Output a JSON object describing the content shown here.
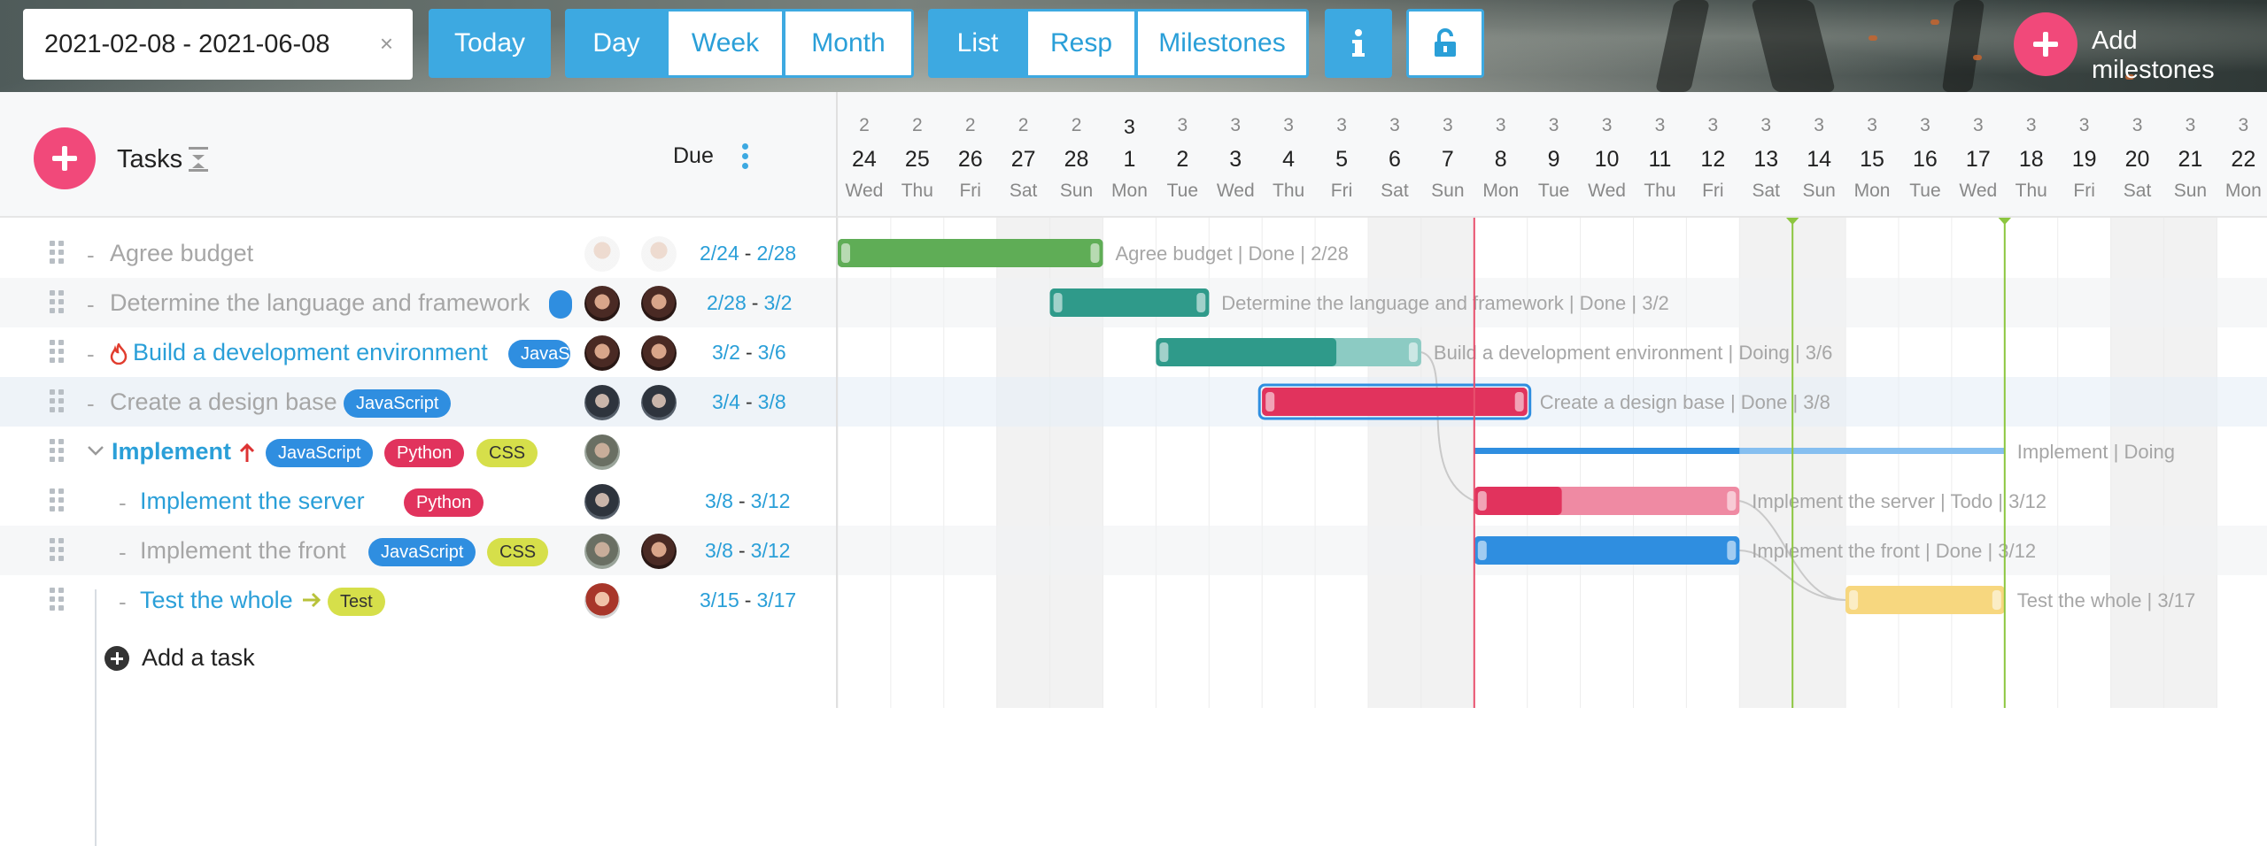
{
  "toolbar": {
    "date_range": "2021-02-08 - 2021-06-08",
    "clear_symbol": "×",
    "today": "Today",
    "views": [
      "Day",
      "Week",
      "Month"
    ],
    "active_view": "Day",
    "modes": [
      "List",
      "Resp",
      "Milestones"
    ],
    "active_mode": "List",
    "info_icon": "info-icon",
    "lock_icon": "unlock-icon",
    "add_milestones": "Add milestones",
    "accent": "#3da9e1",
    "pink": "#f1497a"
  },
  "list_header": {
    "tasks": "Tasks",
    "due": "Due"
  },
  "tasks": [
    {
      "name": "Agree budget",
      "status": "done",
      "tags": [],
      "start": "2/24",
      "due": "2/28",
      "avatars": [
        "light",
        "light"
      ]
    },
    {
      "name": "Determine the language and framework",
      "status": "done",
      "tags": [],
      "start": "2/28",
      "due": "3/2",
      "avatars": [
        "brown",
        "brown"
      ]
    },
    {
      "name": "Build a development environment",
      "status": "active",
      "icon": "fire-icon",
      "tags": [
        "JavaS"
      ],
      "start": "3/2",
      "due": "3/6",
      "avatars": [
        "brown",
        "brown"
      ]
    },
    {
      "name": "Create a design base",
      "status": "done",
      "tags": [
        "JavaScript"
      ],
      "start": "3/4",
      "due": "3/8",
      "avatars": [
        "dark",
        "dark"
      ]
    },
    {
      "name": "Implement",
      "status": "parent",
      "icon": "arrow-up-icon",
      "tags": [
        "JavaScript",
        "Python",
        "CSS"
      ],
      "start": "",
      "due": "",
      "avatars": [
        "grey"
      ]
    },
    {
      "name": "Implement the server",
      "status": "active",
      "tags": [
        "Python"
      ],
      "start": "3/8",
      "due": "3/12",
      "avatars": [
        "dark"
      ]
    },
    {
      "name": "Implement the front",
      "status": "done",
      "tags": [
        "JavaScript",
        "CSS"
      ],
      "start": "3/8",
      "due": "3/12",
      "avatars": [
        "grey",
        "brown"
      ]
    },
    {
      "name": "Test the whole",
      "status": "active",
      "icon": "arrow-right-icon",
      "tags": [
        "Test"
      ],
      "start": "3/15",
      "due": "3/17",
      "avatars": [
        "red"
      ]
    }
  ],
  "add_task": "Add a task",
  "calendar": {
    "days": [
      {
        "m": "2",
        "d": "24",
        "w": "Wed"
      },
      {
        "m": "2",
        "d": "25",
        "w": "Thu"
      },
      {
        "m": "2",
        "d": "26",
        "w": "Fri"
      },
      {
        "m": "2",
        "d": "27",
        "w": "Sat"
      },
      {
        "m": "2",
        "d": "28",
        "w": "Sun"
      },
      {
        "m": "3",
        "d": "1",
        "w": "Mon",
        "first": true
      },
      {
        "m": "3",
        "d": "2",
        "w": "Tue"
      },
      {
        "m": "3",
        "d": "3",
        "w": "Wed"
      },
      {
        "m": "3",
        "d": "4",
        "w": "Thu"
      },
      {
        "m": "3",
        "d": "5",
        "w": "Fri"
      },
      {
        "m": "3",
        "d": "6",
        "w": "Sat"
      },
      {
        "m": "3",
        "d": "7",
        "w": "Sun"
      },
      {
        "m": "3",
        "d": "8",
        "w": "Mon"
      },
      {
        "m": "3",
        "d": "9",
        "w": "Tue"
      },
      {
        "m": "3",
        "d": "10",
        "w": "Wed"
      },
      {
        "m": "3",
        "d": "11",
        "w": "Thu"
      },
      {
        "m": "3",
        "d": "12",
        "w": "Fri"
      },
      {
        "m": "3",
        "d": "13",
        "w": "Sat"
      },
      {
        "m": "3",
        "d": "14",
        "w": "Sun"
      },
      {
        "m": "3",
        "d": "15",
        "w": "Mon"
      },
      {
        "m": "3",
        "d": "16",
        "w": "Tue"
      },
      {
        "m": "3",
        "d": "17",
        "w": "Wed"
      },
      {
        "m": "3",
        "d": "18",
        "w": "Thu"
      },
      {
        "m": "3",
        "d": "19",
        "w": "Fri"
      },
      {
        "m": "3",
        "d": "20",
        "w": "Sat"
      },
      {
        "m": "3",
        "d": "21",
        "w": "Sun"
      },
      {
        "m": "3",
        "d": "22",
        "w": "Mon"
      }
    ],
    "today_index": 12,
    "milestone_indices": [
      18,
      22
    ]
  },
  "bars": [
    {
      "row": 0,
      "start": 0,
      "end": 5,
      "color": "#5fad56",
      "light": "#5fad56",
      "progress": 1.0,
      "label": "Agree budget | Done | 2/28"
    },
    {
      "row": 1,
      "start": 4,
      "end": 7,
      "color": "#2f9a8a",
      "light": "#2f9a8a",
      "progress": 1.0,
      "label": "Determine the language and framework | Done | 3/2"
    },
    {
      "row": 2,
      "start": 6,
      "end": 11,
      "color": "#2f9a8a",
      "light": "#8ccbc3",
      "progress": 0.68,
      "label": "Build a development environment | Doing | 3/6"
    },
    {
      "row": 3,
      "start": 8,
      "end": 13,
      "color": "#e1335d",
      "light": "#e1335d",
      "progress": 1.0,
      "label": "Create a design base | Done | 3/8",
      "selected": true
    },
    {
      "row": 4,
      "start": 12,
      "end": 22,
      "color": "#2f8ee0",
      "light": "#86bff0",
      "progress": 0.5,
      "label": "Implement | Doing",
      "thin": true
    },
    {
      "row": 5,
      "start": 12,
      "end": 17,
      "color": "#e1335d",
      "light": "#ef8aa3",
      "progress": 0.33,
      "label": "Implement the server | Todo | 3/12"
    },
    {
      "row": 6,
      "start": 12,
      "end": 17,
      "color": "#2f8ee0",
      "light": "#2f8ee0",
      "progress": 1.0,
      "label": "Implement the front | Done | 3/12"
    },
    {
      "row": 7,
      "start": 19,
      "end": 22,
      "color": "#f7d77f",
      "light": "#f7d77f",
      "progress": 1.0,
      "label": "Test the whole | 3/17"
    }
  ],
  "colors": {
    "today_line": "#e8506d",
    "milestone_line": "#8cc63f",
    "weekend": "#f2f2f2",
    "link": "#c9c9c9"
  }
}
